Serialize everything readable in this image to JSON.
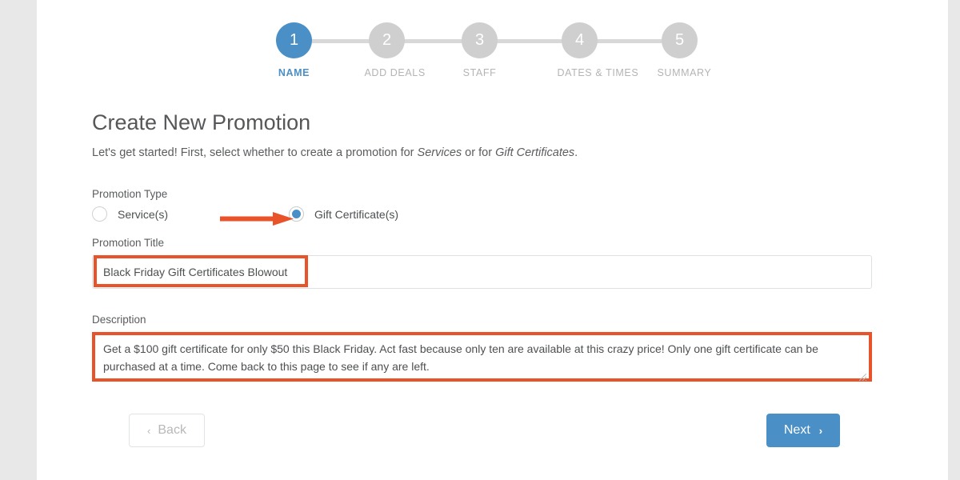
{
  "theme": {
    "accent_blue": "#4a90c6",
    "annotation_orange": "#e8532a",
    "muted_gray": "#b4b4b4",
    "gutter_gray": "#e8e8e8"
  },
  "stepper": {
    "current_step": 1,
    "steps": [
      {
        "number": "1",
        "label": "NAME",
        "active": true
      },
      {
        "number": "2",
        "label": "ADD DEALS",
        "active": false
      },
      {
        "number": "3",
        "label": "STAFF",
        "active": false
      },
      {
        "number": "4",
        "label": "DATES & TIMES",
        "active": false
      },
      {
        "number": "5",
        "label": "SUMMARY",
        "active": false
      }
    ]
  },
  "main": {
    "title": "Create New Promotion",
    "intro": {
      "part1": "Let's get started! First, select whether to create a promotion for ",
      "em1": "Services",
      "part2": " or for ",
      "em2": "Gift Certificates",
      "part3": "."
    },
    "promotion_type": {
      "label": "Promotion Type",
      "options": [
        {
          "value": "services",
          "label": "Service(s)",
          "selected": false
        },
        {
          "value": "gift_certificates",
          "label": "Gift Certificate(s)",
          "selected": true
        }
      ]
    },
    "promotion_title": {
      "label": "Promotion Title",
      "value": "Black Friday Gift Certificates Blowout",
      "placeholder": ""
    },
    "description": {
      "label": "Description",
      "value": "Get a $100 gift certificate for only $50 this Black Friday. Act fast because only ten are available at this crazy price! Only one gift certificate can be purchased at a time. Come back to this page to see if any are left.",
      "placeholder": ""
    }
  },
  "footer": {
    "back_label": "Back",
    "back_chevron": "‹",
    "next_label": "Next",
    "next_chevron": "›"
  },
  "annotations": {
    "arrow_points_to": "Gift Certificate(s) radio button",
    "highlight_title": "Black Friday Gift Certificates Blowout",
    "highlight_description": "Description textarea"
  }
}
